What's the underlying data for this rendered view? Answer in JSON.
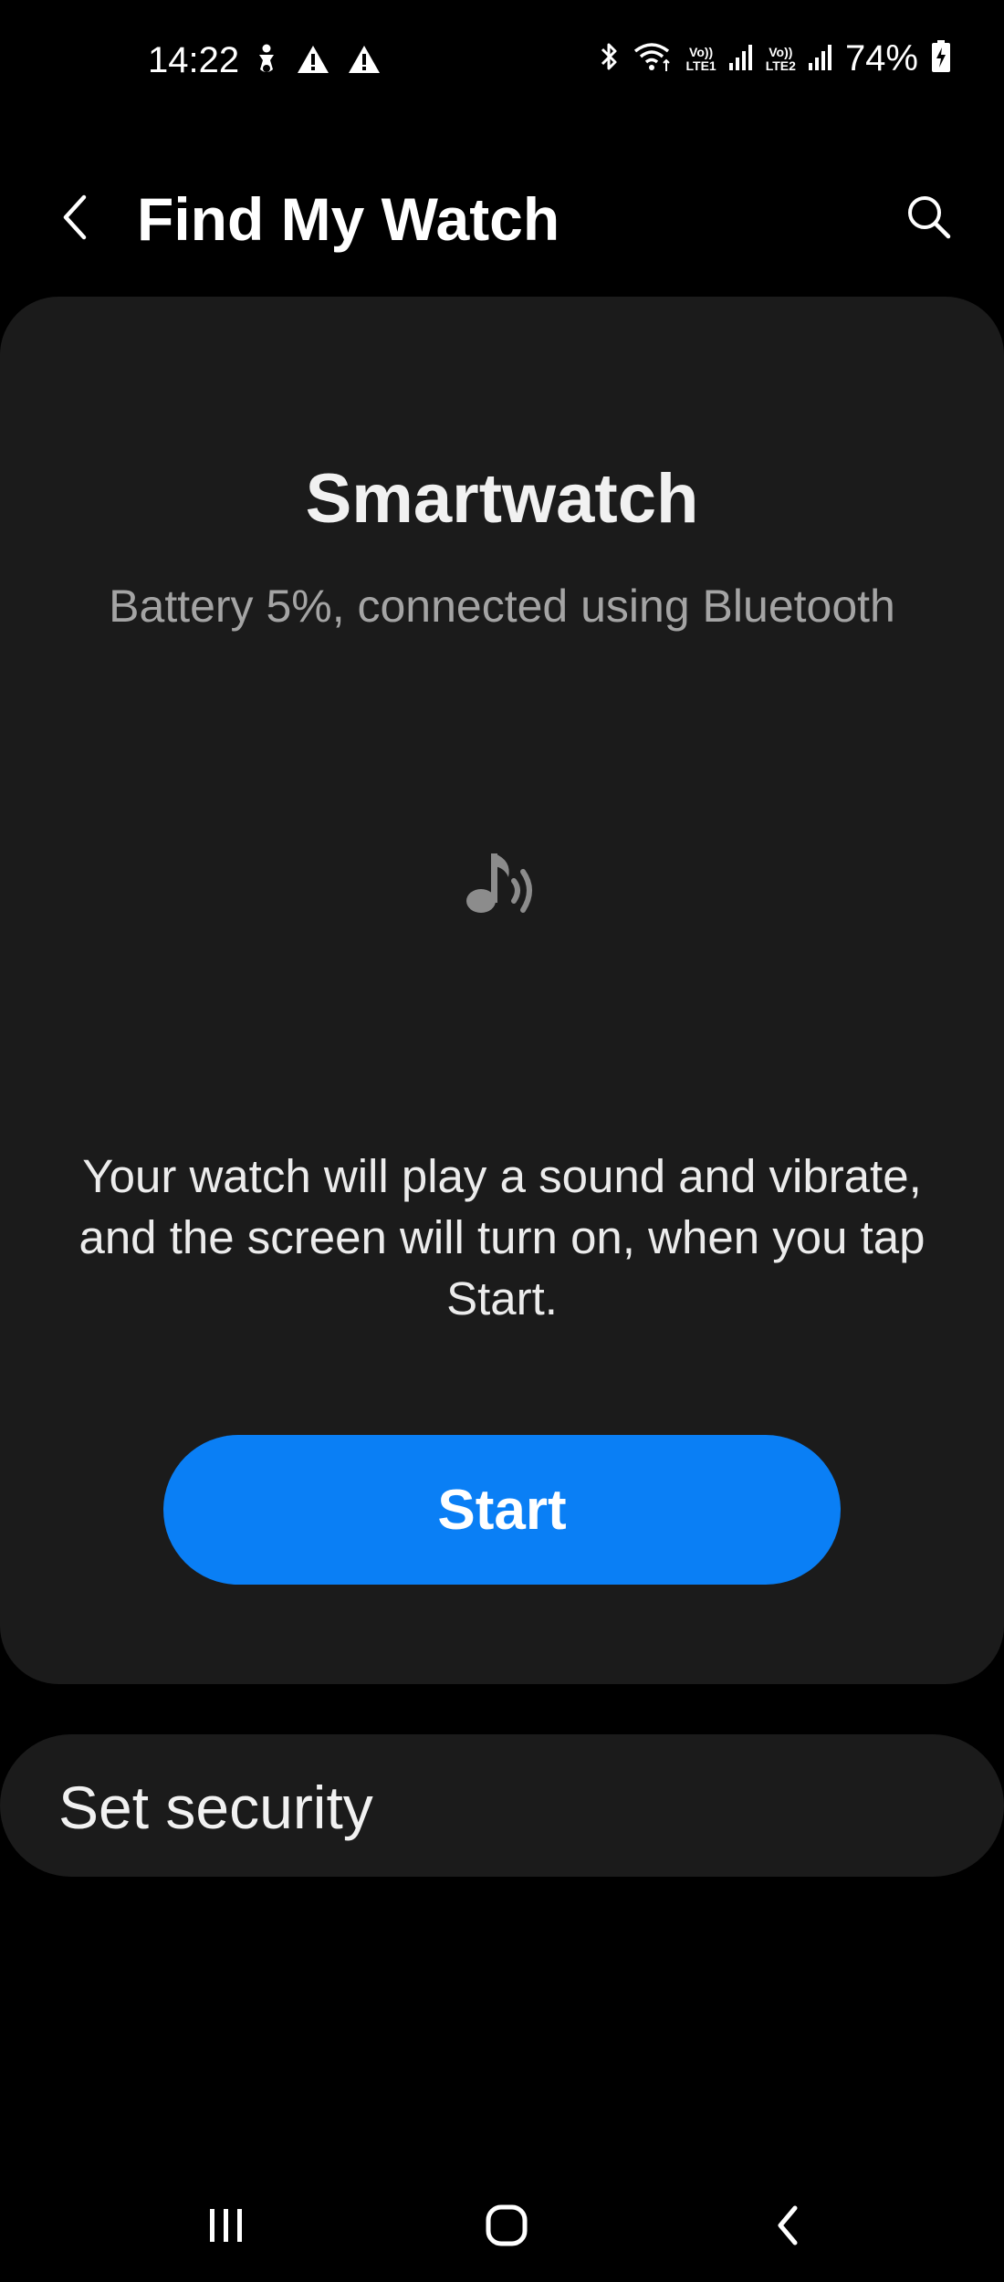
{
  "status_bar": {
    "time": "14:22",
    "left_icons": [
      "accessibility-icon",
      "warning-icon",
      "warning-icon"
    ],
    "right_icons": [
      "bluetooth-icon",
      "wifi-icon",
      "signal-icon",
      "signal-icon",
      "battery-charging-icon"
    ],
    "sim1_top": "Vo))",
    "sim1_bottom": "LTE1",
    "sim2_top": "Vo))",
    "sim2_bottom": "LTE2",
    "battery_percent": "74%"
  },
  "app_bar": {
    "title": "Find My Watch",
    "back_icon": "back-chevron-icon",
    "search_icon": "search-icon"
  },
  "device_card": {
    "device_name": "Smartwatch",
    "status": "Battery 5%, connected using Bluetooth",
    "icon": "sound-icon",
    "description": "Your watch will play a sound and vibrate, and the screen will turn on, when you tap Start.",
    "start_label": "Start",
    "accent_color": "#0a7ff5"
  },
  "security": {
    "label": "Set security"
  },
  "nav_bar": {
    "recents_icon": "recents-icon",
    "home_icon": "home-icon",
    "back_icon": "back-icon"
  }
}
